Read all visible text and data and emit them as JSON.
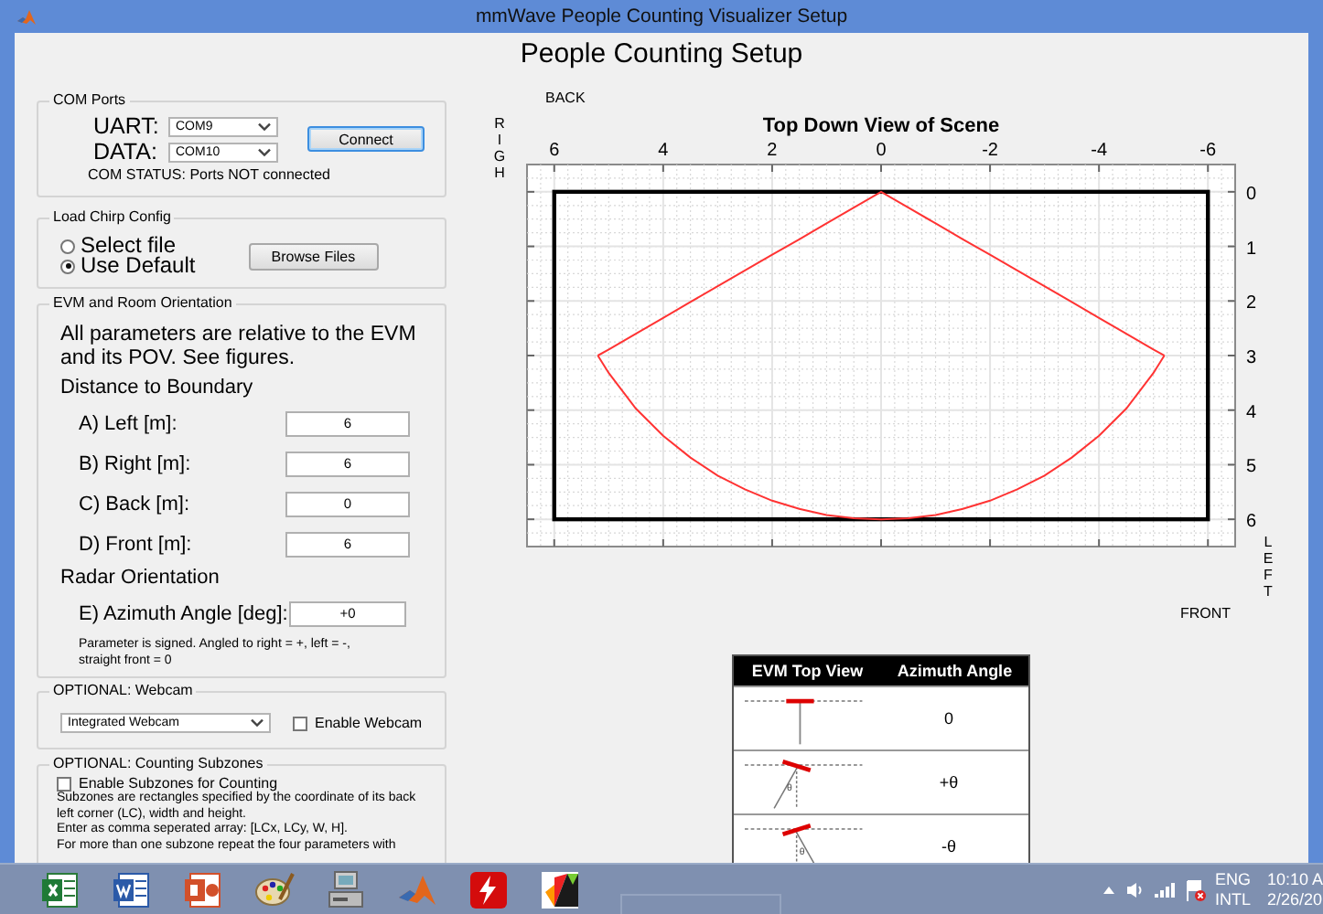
{
  "window": {
    "title": "mmWave People Counting Visualizer Setup"
  },
  "heading": "People Counting Setup",
  "com_ports": {
    "title": "COM Ports",
    "uart": {
      "label": "UART:",
      "value": "COM9"
    },
    "data": {
      "label": "DATA:",
      "value": "COM10"
    },
    "connect_button": "Connect",
    "status": "COM STATUS: Ports NOT connected"
  },
  "chirp_config": {
    "title": "Load Chirp Config",
    "options": [
      {
        "label": "Select file",
        "selected": false
      },
      {
        "label": "Use Default",
        "selected": true
      }
    ],
    "browse_button": "Browse Files"
  },
  "orientation": {
    "title": "EVM and Room Orientation",
    "intro": "All parameters are relative to the EVM and its POV.  See figures.",
    "distance_heading": "Distance to Boundary",
    "distances": [
      {
        "label": "A) Left [m]:",
        "value": "6"
      },
      {
        "label": "B) Right [m]:",
        "value": "6"
      },
      {
        "label": "C) Back [m]:",
        "value": "0"
      },
      {
        "label": "D) Front [m]:",
        "value": "6"
      }
    ],
    "radar_heading": "Radar Orientation",
    "azimuth": {
      "label": "E) Azimuth Angle [deg]:",
      "value": "+0"
    },
    "note": "Parameter is signed. Angled to right = +, left = -, straight front = 0"
  },
  "webcam": {
    "title": "OPTIONAL: Webcam",
    "device": "Integrated Webcam",
    "enable": {
      "label": "Enable Webcam",
      "checked": false
    }
  },
  "subzones": {
    "title": "OPTIONAL: Counting Subzones",
    "enable": {
      "label": "Enable Subzones for Counting",
      "checked": false
    },
    "paragraphs": [
      "Subzones are rectangles specified by the coordinate of its back left corner (LC), width and height.",
      "Enter as comma seperated array: [LCx, LCy, W, H].",
      "For more than one subzone repeat the four parameters with"
    ]
  },
  "scene_view": {
    "labels": {
      "back": "BACK",
      "right": "RIGH",
      "left": "LEFT",
      "front": "FRONT"
    },
    "chart_data": {
      "type": "line",
      "title": "Top Down View of Scene",
      "xlim": [
        6.5,
        -6.5
      ],
      "ylim": [
        6.5,
        -0.5
      ],
      "grid": true,
      "x": [
        5.2,
        5,
        4.5,
        4,
        3.5,
        3,
        2.5,
        2,
        1.5,
        1,
        0.5,
        0,
        -0.5,
        -1,
        -1.5,
        -2,
        -2.5,
        -3,
        -3.5,
        -4,
        -4.5,
        -5,
        -5.2
      ],
      "xticks": [
        6,
        4,
        2,
        0,
        -2,
        -4,
        -6
      ],
      "yticks": [
        0,
        1,
        2,
        3,
        4,
        5,
        6
      ],
      "series": [
        {
          "color": "#ff3333",
          "values": [
            3,
            2.89,
            2.6,
            2.31,
            2.02,
            1.73,
            1.44,
            1.15,
            0.87,
            0.58,
            0.29,
            0,
            0.29,
            0.58,
            0.87,
            1.15,
            1.44,
            1.73,
            2.02,
            2.31,
            2.6,
            2.89,
            3
          ]
        },
        {
          "color": "#ff3333",
          "values": [
            3,
            3.32,
            3.97,
            4.47,
            4.87,
            5.2,
            5.45,
            5.66,
            5.81,
            5.92,
            5.98,
            6,
            5.98,
            5.92,
            5.81,
            5.66,
            5.45,
            5.2,
            4.87,
            4.47,
            3.97,
            3.32,
            3
          ]
        }
      ]
    }
  },
  "angle_table": {
    "columns": [
      "EVM Top View",
      "Azimuth Angle"
    ],
    "rows": [
      {
        "kind": "straight",
        "angle": "0"
      },
      {
        "kind": "right",
        "angle": "+θ",
        "symbol": "θ"
      },
      {
        "kind": "left",
        "angle": "-θ",
        "symbol": "θ"
      }
    ]
  },
  "taskbar": {
    "apps": [
      {
        "kind": "spreadsheet"
      },
      {
        "kind": "document"
      },
      {
        "kind": "presentation"
      },
      {
        "kind": "palette"
      },
      {
        "kind": "computer"
      },
      {
        "kind": "peak"
      },
      {
        "kind": "lightning"
      },
      {
        "kind": "blocks"
      }
    ],
    "language": "ENG",
    "layout": "INTL",
    "time": "10:10 A",
    "date": "2/26/20"
  }
}
